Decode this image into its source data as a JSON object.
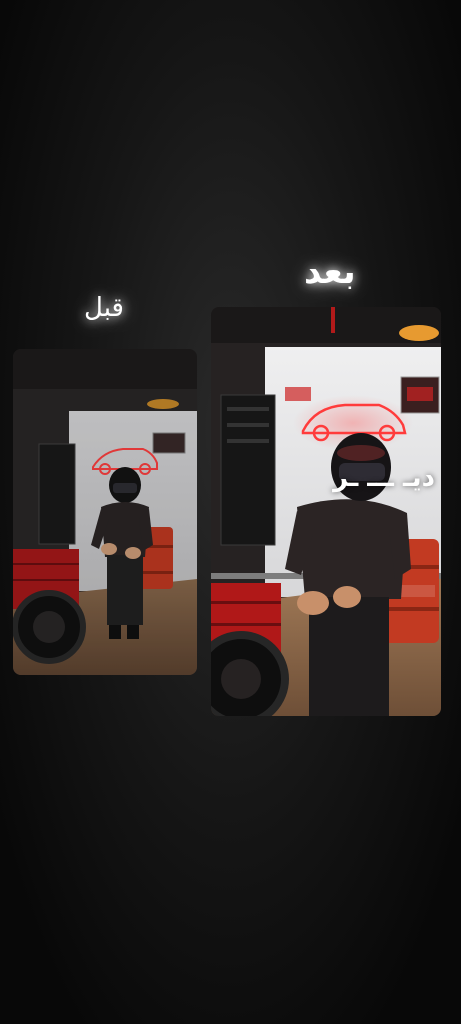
{
  "labels": {
    "before": "قبل",
    "after": "بعد"
  },
  "photos": {
    "before": {
      "name": "before-photo"
    },
    "after": {
      "name": "after-photo",
      "overlay_text": "ديـ ـــ ـر"
    }
  },
  "colors": {
    "background": "#161616",
    "text": "#ffffff",
    "neon": "#ff3b3b",
    "barrel": "#c23a22",
    "cabinet": "#b01818",
    "wall": "#e9e9ea",
    "floor": "#9a7150"
  }
}
